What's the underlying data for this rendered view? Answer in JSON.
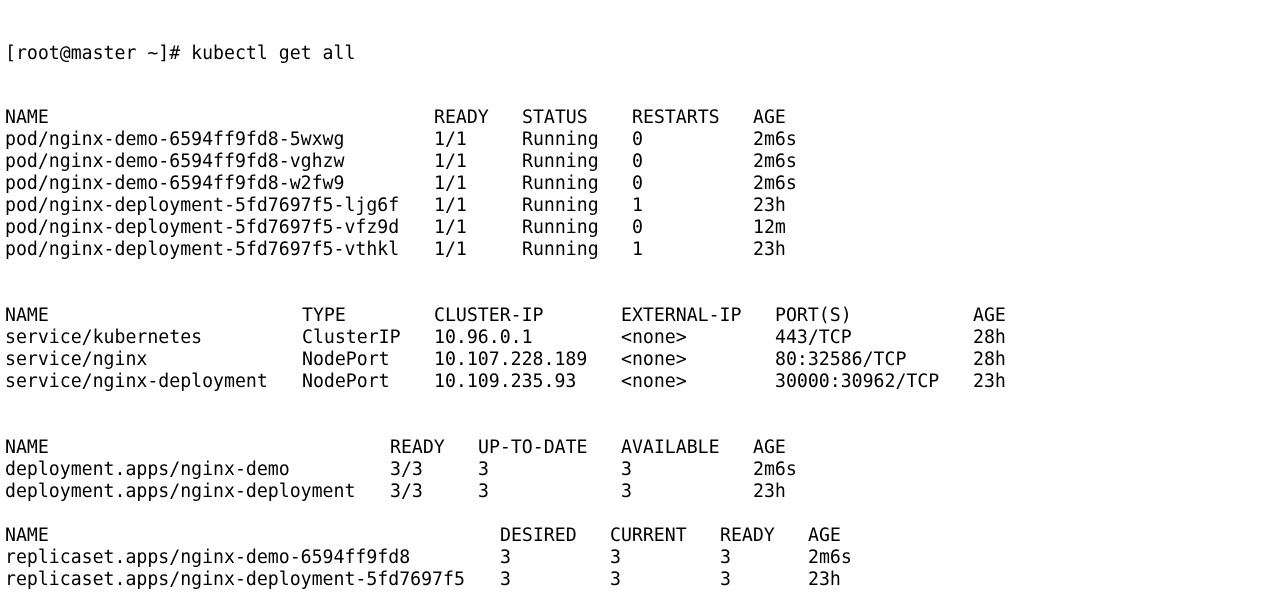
{
  "prompt_line": "[root@master ~]# kubectl get all",
  "sections": [
    {
      "name": "pods",
      "headers": [
        "NAME",
        "READY",
        "STATUS",
        "RESTARTS",
        "AGE"
      ],
      "rows": [
        [
          "pod/nginx-demo-6594ff9fd8-5wxwg",
          "1/1",
          "Running",
          "0",
          "2m6s"
        ],
        [
          "pod/nginx-demo-6594ff9fd8-vghzw",
          "1/1",
          "Running",
          "0",
          "2m6s"
        ],
        [
          "pod/nginx-demo-6594ff9fd8-w2fw9",
          "1/1",
          "Running",
          "0",
          "2m6s"
        ],
        [
          "pod/nginx-deployment-5fd7697f5-ljg6f",
          "1/1",
          "Running",
          "1",
          "23h"
        ],
        [
          "pod/nginx-deployment-5fd7697f5-vfz9d",
          "1/1",
          "Running",
          "0",
          "12m"
        ],
        [
          "pod/nginx-deployment-5fd7697f5-vthkl",
          "1/1",
          "Running",
          "1",
          "23h"
        ]
      ]
    },
    {
      "name": "services",
      "headers": [
        "NAME",
        "TYPE",
        "CLUSTER-IP",
        "EXTERNAL-IP",
        "PORT(S)",
        "AGE"
      ],
      "rows": [
        [
          "service/kubernetes",
          "ClusterIP",
          "10.96.0.1",
          "<none>",
          "443/TCP",
          "28h"
        ],
        [
          "service/nginx",
          "NodePort",
          "10.107.228.189",
          "<none>",
          "80:32586/TCP",
          "28h"
        ],
        [
          "service/nginx-deployment",
          "NodePort",
          "10.109.235.93",
          "<none>",
          "30000:30962/TCP",
          "23h"
        ]
      ]
    },
    {
      "name": "deployments",
      "headers": [
        "NAME",
        "READY",
        "UP-TO-DATE",
        "AVAILABLE",
        "AGE"
      ],
      "rows": [
        [
          "deployment.apps/nginx-demo",
          "3/3",
          "3",
          "3",
          "2m6s"
        ],
        [
          "deployment.apps/nginx-deployment",
          "3/3",
          "3",
          "3",
          "23h"
        ]
      ]
    },
    {
      "name": "replicasets",
      "headers": [
        "NAME",
        "DESIRED",
        "CURRENT",
        "READY",
        "AGE"
      ],
      "rows": [
        [
          "replicaset.apps/nginx-demo-6594ff9fd8",
          "3",
          "3",
          "3",
          "2m6s"
        ],
        [
          "replicaset.apps/nginx-deployment-5fd7697f5",
          "3",
          "3",
          "3",
          "23h"
        ]
      ]
    }
  ]
}
